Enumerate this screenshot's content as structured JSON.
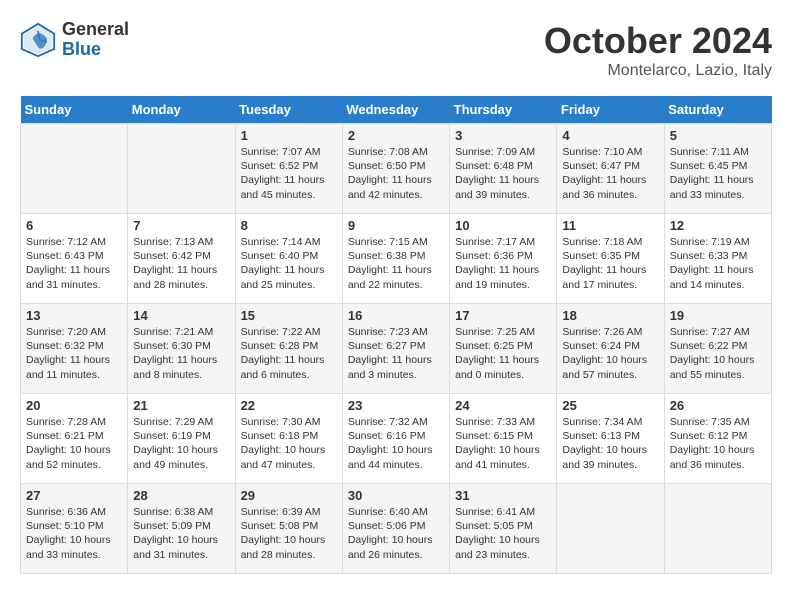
{
  "logo": {
    "general": "General",
    "blue": "Blue"
  },
  "title": "October 2024",
  "subtitle": "Montelarco, Lazio, Italy",
  "days_header": [
    "Sunday",
    "Monday",
    "Tuesday",
    "Wednesday",
    "Thursday",
    "Friday",
    "Saturday"
  ],
  "weeks": [
    [
      {
        "day": "",
        "info": ""
      },
      {
        "day": "",
        "info": ""
      },
      {
        "day": "1",
        "info": "Sunrise: 7:07 AM\nSunset: 6:52 PM\nDaylight: 11 hours and 45 minutes."
      },
      {
        "day": "2",
        "info": "Sunrise: 7:08 AM\nSunset: 6:50 PM\nDaylight: 11 hours and 42 minutes."
      },
      {
        "day": "3",
        "info": "Sunrise: 7:09 AM\nSunset: 6:48 PM\nDaylight: 11 hours and 39 minutes."
      },
      {
        "day": "4",
        "info": "Sunrise: 7:10 AM\nSunset: 6:47 PM\nDaylight: 11 hours and 36 minutes."
      },
      {
        "day": "5",
        "info": "Sunrise: 7:11 AM\nSunset: 6:45 PM\nDaylight: 11 hours and 33 minutes."
      }
    ],
    [
      {
        "day": "6",
        "info": "Sunrise: 7:12 AM\nSunset: 6:43 PM\nDaylight: 11 hours and 31 minutes."
      },
      {
        "day": "7",
        "info": "Sunrise: 7:13 AM\nSunset: 6:42 PM\nDaylight: 11 hours and 28 minutes."
      },
      {
        "day": "8",
        "info": "Sunrise: 7:14 AM\nSunset: 6:40 PM\nDaylight: 11 hours and 25 minutes."
      },
      {
        "day": "9",
        "info": "Sunrise: 7:15 AM\nSunset: 6:38 PM\nDaylight: 11 hours and 22 minutes."
      },
      {
        "day": "10",
        "info": "Sunrise: 7:17 AM\nSunset: 6:36 PM\nDaylight: 11 hours and 19 minutes."
      },
      {
        "day": "11",
        "info": "Sunrise: 7:18 AM\nSunset: 6:35 PM\nDaylight: 11 hours and 17 minutes."
      },
      {
        "day": "12",
        "info": "Sunrise: 7:19 AM\nSunset: 6:33 PM\nDaylight: 11 hours and 14 minutes."
      }
    ],
    [
      {
        "day": "13",
        "info": "Sunrise: 7:20 AM\nSunset: 6:32 PM\nDaylight: 11 hours and 11 minutes."
      },
      {
        "day": "14",
        "info": "Sunrise: 7:21 AM\nSunset: 6:30 PM\nDaylight: 11 hours and 8 minutes."
      },
      {
        "day": "15",
        "info": "Sunrise: 7:22 AM\nSunset: 6:28 PM\nDaylight: 11 hours and 6 minutes."
      },
      {
        "day": "16",
        "info": "Sunrise: 7:23 AM\nSunset: 6:27 PM\nDaylight: 11 hours and 3 minutes."
      },
      {
        "day": "17",
        "info": "Sunrise: 7:25 AM\nSunset: 6:25 PM\nDaylight: 11 hours and 0 minutes."
      },
      {
        "day": "18",
        "info": "Sunrise: 7:26 AM\nSunset: 6:24 PM\nDaylight: 10 hours and 57 minutes."
      },
      {
        "day": "19",
        "info": "Sunrise: 7:27 AM\nSunset: 6:22 PM\nDaylight: 10 hours and 55 minutes."
      }
    ],
    [
      {
        "day": "20",
        "info": "Sunrise: 7:28 AM\nSunset: 6:21 PM\nDaylight: 10 hours and 52 minutes."
      },
      {
        "day": "21",
        "info": "Sunrise: 7:29 AM\nSunset: 6:19 PM\nDaylight: 10 hours and 49 minutes."
      },
      {
        "day": "22",
        "info": "Sunrise: 7:30 AM\nSunset: 6:18 PM\nDaylight: 10 hours and 47 minutes."
      },
      {
        "day": "23",
        "info": "Sunrise: 7:32 AM\nSunset: 6:16 PM\nDaylight: 10 hours and 44 minutes."
      },
      {
        "day": "24",
        "info": "Sunrise: 7:33 AM\nSunset: 6:15 PM\nDaylight: 10 hours and 41 minutes."
      },
      {
        "day": "25",
        "info": "Sunrise: 7:34 AM\nSunset: 6:13 PM\nDaylight: 10 hours and 39 minutes."
      },
      {
        "day": "26",
        "info": "Sunrise: 7:35 AM\nSunset: 6:12 PM\nDaylight: 10 hours and 36 minutes."
      }
    ],
    [
      {
        "day": "27",
        "info": "Sunrise: 6:36 AM\nSunset: 5:10 PM\nDaylight: 10 hours and 33 minutes."
      },
      {
        "day": "28",
        "info": "Sunrise: 6:38 AM\nSunset: 5:09 PM\nDaylight: 10 hours and 31 minutes."
      },
      {
        "day": "29",
        "info": "Sunrise: 6:39 AM\nSunset: 5:08 PM\nDaylight: 10 hours and 28 minutes."
      },
      {
        "day": "30",
        "info": "Sunrise: 6:40 AM\nSunset: 5:06 PM\nDaylight: 10 hours and 26 minutes."
      },
      {
        "day": "31",
        "info": "Sunrise: 6:41 AM\nSunset: 5:05 PM\nDaylight: 10 hours and 23 minutes."
      },
      {
        "day": "",
        "info": ""
      },
      {
        "day": "",
        "info": ""
      }
    ]
  ]
}
